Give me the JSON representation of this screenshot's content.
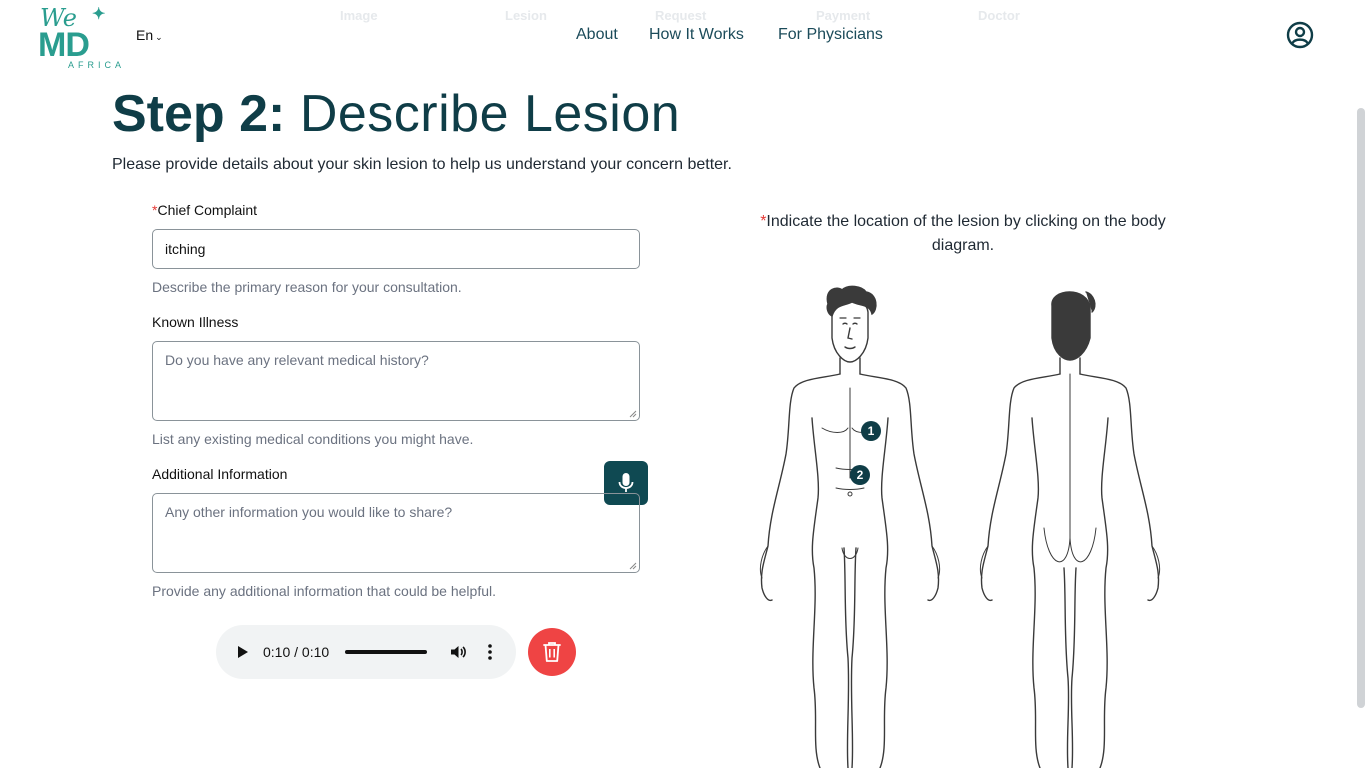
{
  "header": {
    "logo_top": "We",
    "logo_main": "MD",
    "logo_sub": "AFRICA",
    "language": "En",
    "ghost_steps": [
      "Image",
      "Lesion",
      "Request",
      "Payment",
      "Doctor"
    ],
    "nav": [
      "About",
      "How It Works",
      "For Physicians"
    ],
    "icons": {
      "profile": "user-circle-icon",
      "chevron": "chevron-down-icon"
    }
  },
  "page": {
    "title_step": "Step 2:",
    "title_text": "Describe Lesion",
    "subtitle": "Please provide details about your skin lesion to help us understand your concern better."
  },
  "form": {
    "chief_complaint": {
      "required_mark": "*",
      "label": "Chief Complaint",
      "value": "itching",
      "help": "Describe the primary reason for your consultation."
    },
    "known_illness": {
      "label": "Known Illness",
      "placeholder": "Do you have any relevant medical history?",
      "help": "List any existing medical conditions you might have."
    },
    "additional_info": {
      "label": "Additional Information",
      "placeholder": "Any other information you would like to share?",
      "help": "Provide any additional information that could be helpful."
    },
    "mic_icon": "microphone-icon"
  },
  "audio": {
    "time": "0:10 / 0:10",
    "progress": 1.0,
    "icons": {
      "play": "play-icon",
      "volume": "volume-icon",
      "more": "more-vertical-icon",
      "delete": "trash-icon"
    }
  },
  "diagram": {
    "required_mark": "*",
    "instruction": "Indicate the location of the lesion by clicking on the body diagram.",
    "markers": [
      "1",
      "2"
    ]
  },
  "colors": {
    "brand": "#2a9d8f",
    "primary_dark": "#0f3d47",
    "danger": "#ef4444",
    "required": "#e53935"
  }
}
